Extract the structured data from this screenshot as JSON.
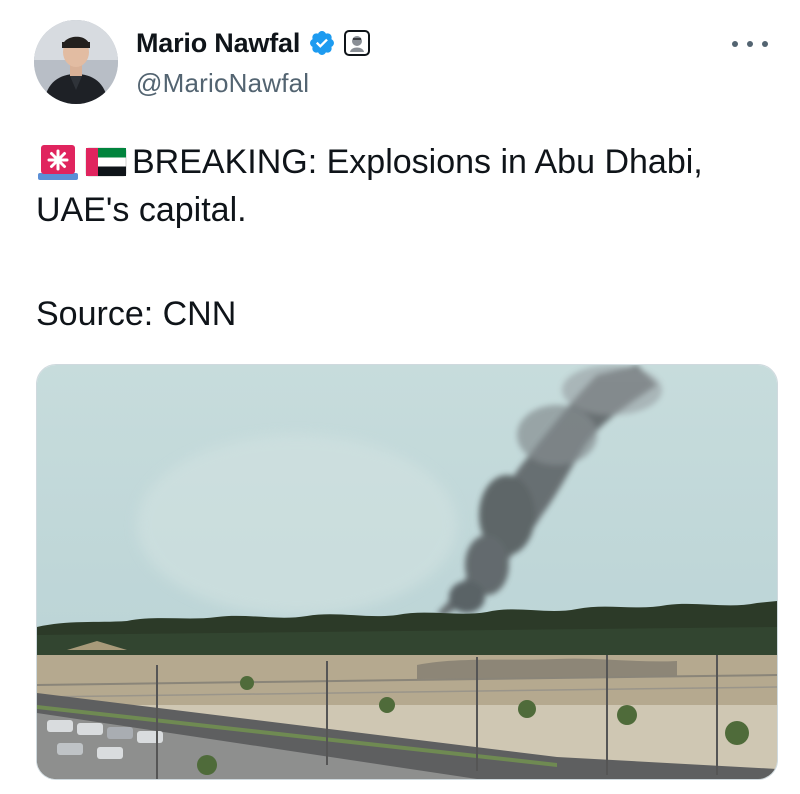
{
  "tweet": {
    "author": {
      "display_name": "Mario Nawfal",
      "handle": "@MarioNawfal",
      "verified_icon": "verified-badge-icon",
      "affiliation_icon": "affiliation-badge-icon"
    },
    "more_icon": "more-options-icon",
    "text": {
      "emojis": [
        "rotating-light-icon",
        "uae-flag-icon"
      ],
      "line1": "BREAKING: Explosions in Abu Dhabi,",
      "line2": "UAE's capital.",
      "source": "Source: CNN"
    },
    "media": {
      "kind": "photo",
      "subject": "smoke-plume-over-city-photo"
    }
  },
  "colors": {
    "text": "#0f1419",
    "secondary_text": "#536471",
    "verified_blue": "#1d9bf0",
    "border": "#cfd9de"
  }
}
